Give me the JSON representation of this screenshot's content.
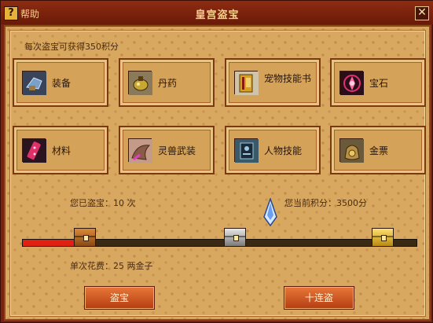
{
  "window": {
    "title": "皇宫盗宝",
    "help_label": "帮助",
    "help_icon": "?",
    "close_icon": "✕"
  },
  "info": {
    "points_note": "每次盗宝可获得350积分",
    "mined_count": "您已盗宝：10 次",
    "current_points": "您当前积分：3500分",
    "cost": "单次花费：25 两金子"
  },
  "categories": [
    {
      "label": "装备",
      "icon": "equipment-icon"
    },
    {
      "label": "丹药",
      "icon": "elixir-icon"
    },
    {
      "label": "宠物技能书",
      "icon": "pet-skill-book-icon"
    },
    {
      "label": "宝石",
      "icon": "gem-icon"
    },
    {
      "label": "材料",
      "icon": "material-icon"
    },
    {
      "label": "灵兽武装",
      "icon": "spirit-beast-armor-icon"
    },
    {
      "label": "人物技能",
      "icon": "character-skill-icon"
    },
    {
      "label": "金票",
      "icon": "gold-ticket-icon"
    }
  ],
  "progress": {
    "fill_fraction": 0.14,
    "chests": [
      "bronze-chest-icon",
      "silver-chest-icon",
      "gold-chest-icon"
    ]
  },
  "buttons": {
    "mine": "盗宝",
    "mine_ten": "十连盗"
  },
  "colors": {
    "title_bar": "#7a2410",
    "panel": "#d9a860",
    "progress_fill": "#e02010",
    "button": "#d05a24"
  }
}
